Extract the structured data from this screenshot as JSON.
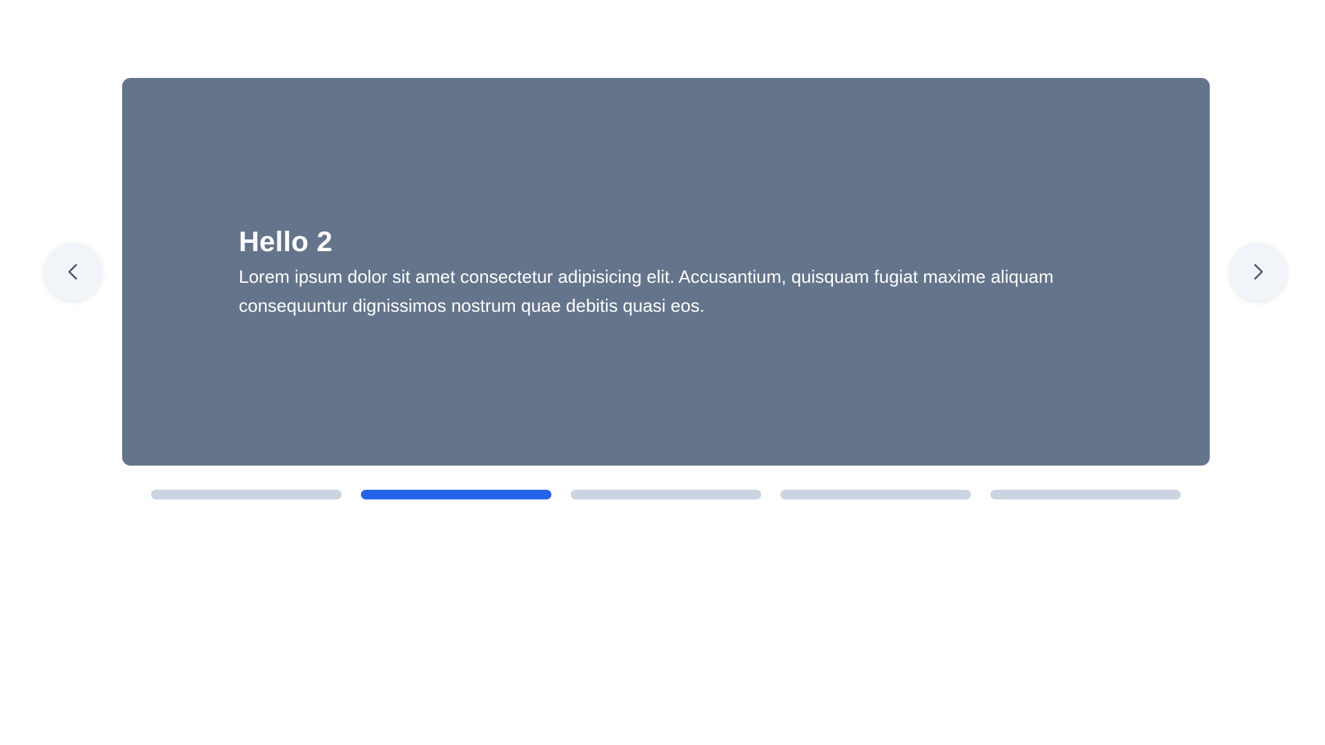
{
  "carousel": {
    "active_index": 1,
    "slide": {
      "title": "Hello 2",
      "body": "Lorem ipsum dolor sit amet consectetur adipisicing elit. Accusantium, quisquam fugiat maxime aliquam consequuntur dignissimos nostrum quae debitis quasi eos."
    },
    "controls": {
      "prev_icon": "chevron-left-icon",
      "next_icon": "chevron-right-icon"
    },
    "indicators": [
      {
        "active": false
      },
      {
        "active": true
      },
      {
        "active": false
      },
      {
        "active": false
      },
      {
        "active": false
      }
    ]
  },
  "colors": {
    "slide_background": "#64748b",
    "indicator_inactive": "#cbd5e1",
    "indicator_active": "#2563eb",
    "nav_button_background": "#f1f5f9",
    "chevron": "#475569",
    "text": "#ffffff"
  }
}
